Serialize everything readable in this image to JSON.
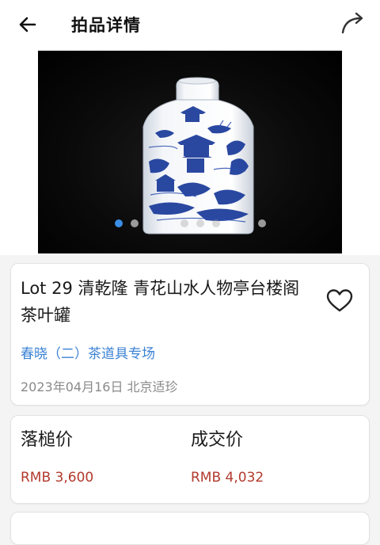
{
  "header": {
    "title": "拍品详情",
    "back_icon": "arrow-left-icon",
    "share_icon": "share-arrow-icon"
  },
  "carousel": {
    "image_alt": "青花山水人物亭台楼阁茶叶罐",
    "slide_count": 6,
    "active_index": 0,
    "colors": {
      "active": "#3a8ee6",
      "inactive": "#9a9a9a"
    }
  },
  "lot": {
    "title": "Lot 29 清乾隆 青花山水人物亭台楼阁茶叶罐",
    "sale_name": "春晓（二）茶道具专场",
    "date_venue": "2023年04月16日 北京适珍",
    "favorite_icon": "heart-outline-icon"
  },
  "prices": {
    "hammer_label": "落槌价",
    "hammer_value": "RMB 3,600",
    "deal_label": "成交价",
    "deal_value": "RMB 4,032",
    "value_color": "#b23a2e"
  }
}
